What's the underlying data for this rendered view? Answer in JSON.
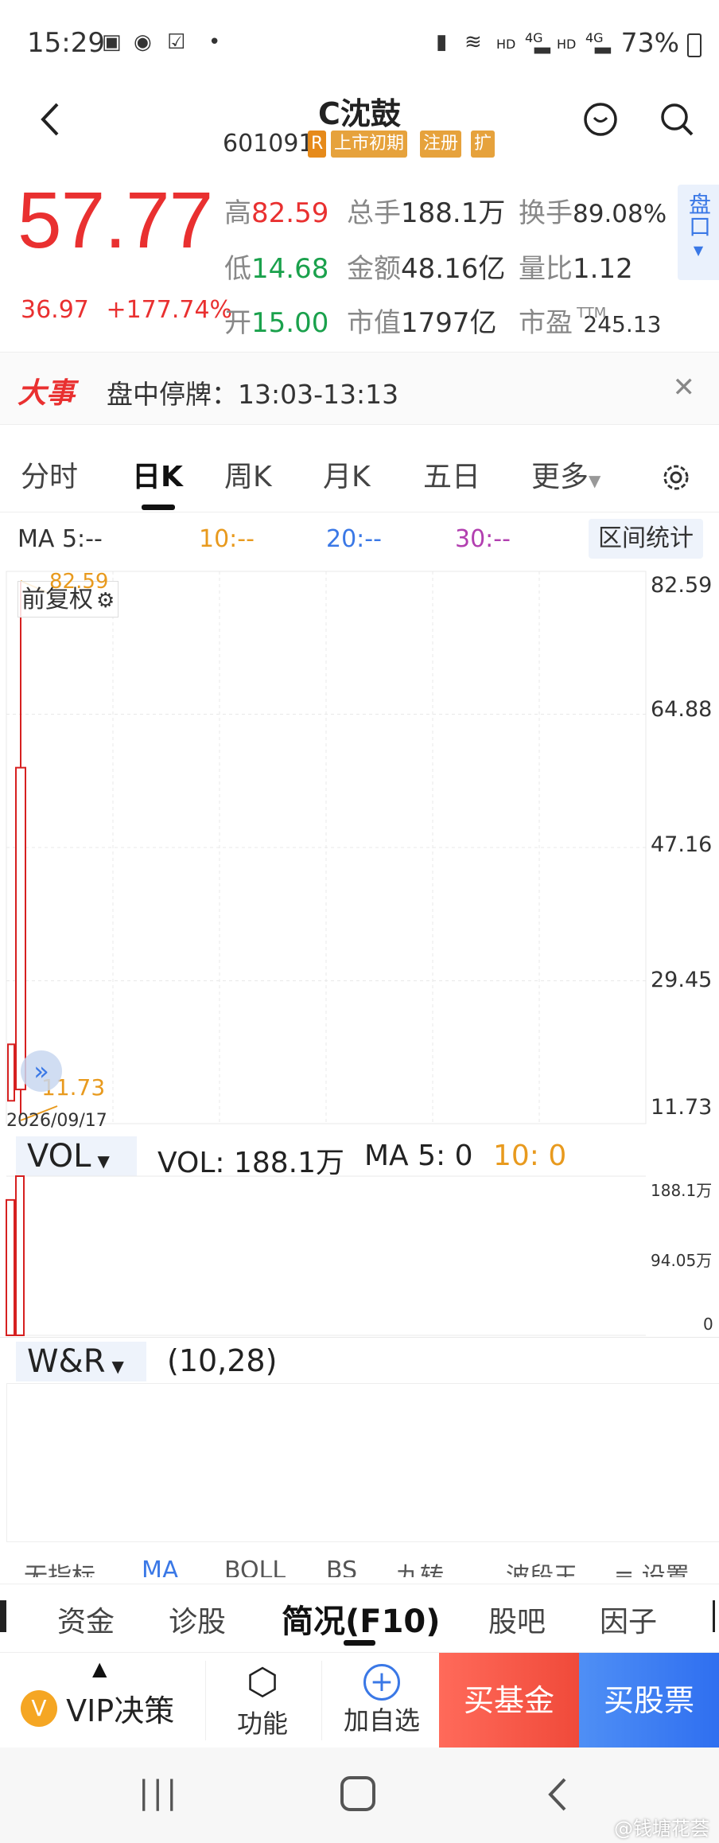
{
  "status_bar": {
    "time": "15:29",
    "network_hd": "HD",
    "network_4g": "4G",
    "battery": "73%"
  },
  "header": {
    "name": "C沈鼓",
    "code": "601091",
    "tags": [
      "R",
      "上市初期",
      "注册",
      "扩"
    ]
  },
  "quote": {
    "price": "57.77",
    "change": "36.97",
    "change_pct": "+177.74%",
    "high_label": "高",
    "high": "82.59",
    "low_label": "低",
    "low": "14.68",
    "open_label": "开",
    "open": "15.00",
    "volume_label": "总手",
    "volume": "188.1万",
    "amount_label": "金额",
    "amount": "48.16亿",
    "mktcap_label": "市值",
    "mktcap": "1797亿",
    "turnover_label": "换手",
    "turnover": "89.08%",
    "vol_ratio_label": "量比",
    "vol_ratio": "1.12",
    "pe_label": "市盈",
    "pe_sup": "TTM",
    "pe": "245.13",
    "pankou": "盘口"
  },
  "event": {
    "tag": "大事",
    "text": "盘中停牌：13:03-13:13"
  },
  "tabs": [
    "分时",
    "日K",
    "周K",
    "月K",
    "五日",
    "更多"
  ],
  "ma": {
    "ma5": "MA 5:--",
    "ma10": "10:--",
    "ma20": "20:--",
    "ma30": "30:--",
    "range_btn": "区间统计"
  },
  "chart": {
    "fq_label": "前复权",
    "date_label": "2026/09/17",
    "high_mark": "82.59",
    "low_mark": "11.73",
    "y_ticks": [
      "82.59",
      "64.88",
      "47.16",
      "29.45",
      "11.73"
    ]
  },
  "chart_data": {
    "type": "candlestick",
    "dates": [
      "2026/09/17"
    ],
    "candles": [
      {
        "open": 15.0,
        "high": 82.59,
        "low": 11.73,
        "close": 57.77
      }
    ],
    "ylim": [
      11.73,
      82.59
    ],
    "colors": {
      "up": "#d62020",
      "ma10": "#e89a1e",
      "ma20": "#3a78e6",
      "ma30": "#b23fb0"
    }
  },
  "vol": {
    "selector": "VOL",
    "text": "VOL: 188.1万",
    "ma5": "MA 5: 0",
    "ma10": "10: 0",
    "y_ticks": [
      "188.1万",
      "94.05万",
      "0"
    ]
  },
  "wr": {
    "selector": "W&R",
    "params": "(10,28)"
  },
  "indicator_row": [
    "无指标",
    "MA",
    "BOLL",
    "BS",
    "九转",
    "波段王",
    "设置"
  ],
  "nav2": [
    "资金",
    "诊股",
    "简况(F10)",
    "股吧",
    "因子"
  ],
  "actions": {
    "vip": "VIP决策",
    "func": "功能",
    "add": "加自选",
    "buy_fund": "买基金",
    "buy_stock": "买股票"
  },
  "watermark": "@钱塘花荟"
}
